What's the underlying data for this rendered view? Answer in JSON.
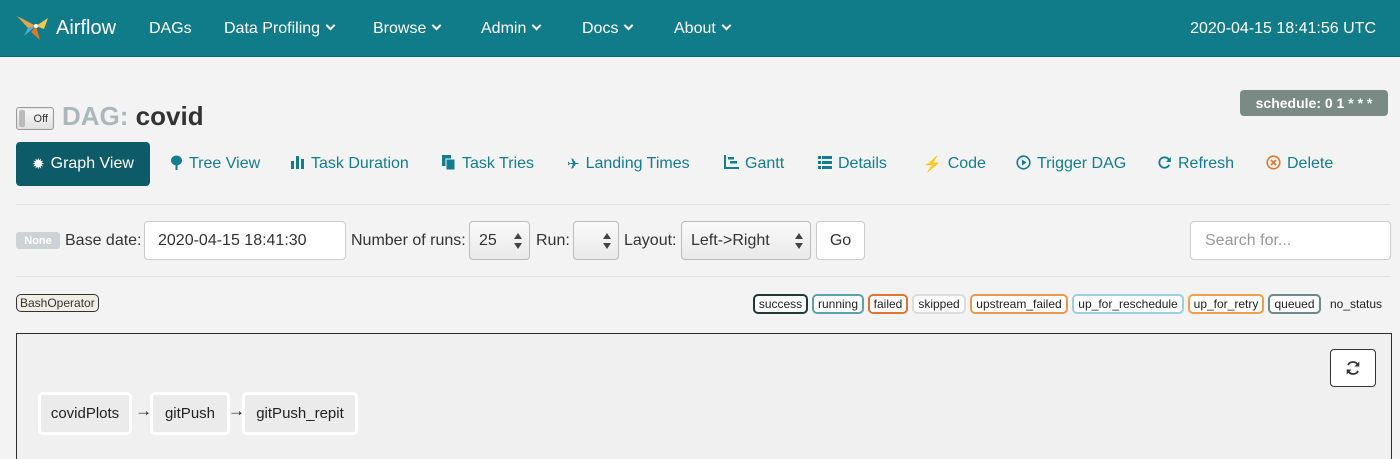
{
  "navbar": {
    "brand": "Airflow",
    "items": [
      {
        "label": "DAGs"
      },
      {
        "label": "Data Profiling"
      },
      {
        "label": "Browse"
      },
      {
        "label": "Admin"
      },
      {
        "label": "Docs"
      },
      {
        "label": "About"
      }
    ],
    "clock": "2020-04-15 18:41:56 UTC"
  },
  "dag": {
    "toggle_label": "Off",
    "title_prefix": "DAG:",
    "name": "covid",
    "schedule": "schedule: 0 1 * * *"
  },
  "tabs": [
    {
      "label": "Graph View",
      "icon": "asterisk-icon"
    },
    {
      "label": "Tree View",
      "icon": "tree-icon"
    },
    {
      "label": "Task Duration",
      "icon": "bar-chart-icon"
    },
    {
      "label": "Task Tries",
      "icon": "files-icon"
    },
    {
      "label": "Landing Times",
      "icon": "plane-icon"
    },
    {
      "label": "Gantt",
      "icon": "gantt-icon"
    },
    {
      "label": "Details",
      "icon": "list-icon"
    },
    {
      "label": "Code",
      "icon": "flash-icon"
    },
    {
      "label": "Trigger DAG",
      "icon": "play-circle-icon"
    },
    {
      "label": "Refresh",
      "icon": "refresh-icon"
    },
    {
      "label": "Delete",
      "icon": "remove-circle-icon"
    }
  ],
  "form": {
    "state_badge": "None",
    "base_date_label": "Base date:",
    "base_date_value": "2020-04-15 18:41:30",
    "num_runs_label": "Number of runs:",
    "num_runs_value": "25",
    "run_label": "Run:",
    "run_value": "",
    "layout_label": "Layout:",
    "layout_value": "Left->Right",
    "go_label": "Go",
    "search_placeholder": "Search for..."
  },
  "legend": {
    "operator": "BashOperator",
    "statuses": [
      {
        "label": "success",
        "color": "#1f3a36"
      },
      {
        "label": "running",
        "color": "#4d9aa6"
      },
      {
        "label": "failed",
        "color": "#e0752d"
      },
      {
        "label": "skipped",
        "color": "#dddddd"
      },
      {
        "label": "upstream_failed",
        "color": "#e89a4f"
      },
      {
        "label": "up_for_reschedule",
        "color": "#9ecfe0"
      },
      {
        "label": "up_for_retry",
        "color": "#f0a04b"
      },
      {
        "label": "queued",
        "color": "#6b8a8a"
      },
      {
        "label": "no_status",
        "color": "#ffffff"
      }
    ]
  },
  "graph": {
    "nodes": [
      {
        "label": "covidPlots"
      },
      {
        "label": "gitPush"
      },
      {
        "label": "gitPush_repit"
      }
    ],
    "edge_symbol": "→"
  },
  "colors": {
    "navbar": "#107b89",
    "tab_active": "#0d5a69",
    "tab_text": "#137d8f",
    "schedule_bg": "#7a8a85"
  }
}
